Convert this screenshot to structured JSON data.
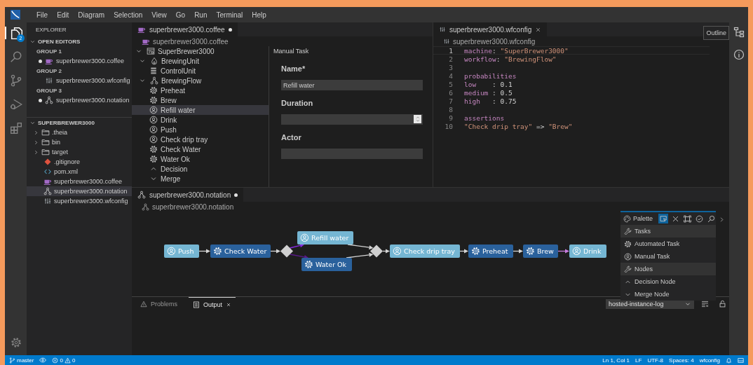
{
  "menu": [
    "File",
    "Edit",
    "Diagram",
    "Selection",
    "View",
    "Go",
    "Run",
    "Terminal",
    "Help"
  ],
  "activity_bar": {
    "items": [
      {
        "kind": "files",
        "selected": true,
        "badge": "2"
      },
      {
        "kind": "search",
        "selected": false
      },
      {
        "kind": "scm",
        "selected": false
      },
      {
        "kind": "debug",
        "selected": false
      },
      {
        "kind": "extensions",
        "selected": false
      }
    ]
  },
  "explorer": {
    "title": "EXPLORER",
    "open_editors": {
      "header": "OPEN EDITORS",
      "expanded": true,
      "groups": [
        {
          "label": "GROUP 1",
          "files": [
            {
              "name": "superbrewer3000.coffee",
              "kind": "coffee",
              "dirty": true
            }
          ]
        },
        {
          "label": "GROUP 2",
          "files": [
            {
              "name": "superbrewer3000.wfconfig",
              "kind": "wfconfig",
              "dirty": false
            }
          ]
        },
        {
          "label": "GROUP 3",
          "files": [
            {
              "name": "superbrewer3000.notation",
              "kind": "notation",
              "dirty": true
            }
          ]
        }
      ]
    },
    "project": {
      "header": "SUPERBREWER3000",
      "expanded": true,
      "items": [
        {
          "name": ".theia",
          "kind": "folder",
          "expanded": false,
          "selected": false
        },
        {
          "name": "bin",
          "kind": "folder",
          "expanded": false,
          "selected": false
        },
        {
          "name": "target",
          "kind": "folder",
          "expanded": false,
          "selected": false
        },
        {
          "name": ".gitignore",
          "kind": "git",
          "selected": false
        },
        {
          "name": "pom.xml",
          "kind": "xml",
          "selected": false
        },
        {
          "name": "superbrewer3000.coffee",
          "kind": "coffee",
          "selected": false
        },
        {
          "name": "superbrewer3000.notation",
          "kind": "notation",
          "selected": true
        },
        {
          "name": "superbrewer3000.wfconfig",
          "kind": "wfconfig",
          "selected": false
        }
      ]
    }
  },
  "coffee_editor": {
    "tab": {
      "label": "superbrewer3000.coffee",
      "kind": "coffee",
      "dirty": true
    },
    "breadcrumb": "superbrewer3000.coffee",
    "tree": [
      {
        "label": "SuperBrewer3000",
        "kind": "machine",
        "expanded": true,
        "selected": false,
        "children": [
          {
            "label": "BrewingUnit",
            "kind": "unit",
            "expanded": true,
            "selected": false,
            "children": [
              {
                "label": "ControlUnit",
                "kind": "controlunit",
                "selected": false
              }
            ]
          },
          {
            "label": "BrewingFlow",
            "kind": "notation",
            "expanded": true,
            "selected": false,
            "children": [
              {
                "label": "Preheat",
                "kind": "automated",
                "selected": false
              },
              {
                "label": "Brew",
                "kind": "automated",
                "selected": false
              },
              {
                "label": "Refill water",
                "kind": "manual",
                "selected": true
              },
              {
                "label": "Drink",
                "kind": "manual",
                "selected": false
              },
              {
                "label": "Push",
                "kind": "manual",
                "selected": false
              },
              {
                "label": "Check drip tray",
                "kind": "manual",
                "selected": false
              },
              {
                "label": "Check Water",
                "kind": "automated",
                "selected": false
              },
              {
                "label": "Water Ok",
                "kind": "automated",
                "selected": false
              },
              {
                "label": "Decision",
                "kind": "decision",
                "selected": false
              },
              {
                "label": "Merge",
                "kind": "merge",
                "selected": false
              }
            ]
          }
        ]
      }
    ],
    "properties": {
      "title": "Manual Task",
      "fields": [
        {
          "label": "Name*",
          "kind": "text",
          "value": "Refill water"
        },
        {
          "label": "Duration",
          "kind": "number"
        },
        {
          "label": "Actor",
          "kind": "text"
        }
      ]
    }
  },
  "wfconfig_editor": {
    "tab": {
      "label": "superbrewer3000.wfconfig",
      "kind": "wfconfig",
      "closable": true
    },
    "breadcrumb": "superbrewer3000.wfconfig",
    "lines": [
      {
        "number": "1",
        "current": true,
        "tokens": [
          {
            "text": "machine",
            "kind": "key"
          },
          {
            "text": ": ",
            "kind": "plain"
          },
          {
            "text": "\"SuperBrewer3000\"",
            "kind": "string"
          }
        ]
      },
      {
        "number": "2",
        "current": false,
        "tokens": [
          {
            "text": "workflow",
            "kind": "key"
          },
          {
            "text": ": ",
            "kind": "plain"
          },
          {
            "text": "\"BrewingFlow\"",
            "kind": "string"
          }
        ]
      },
      {
        "number": "3",
        "current": false
      },
      {
        "number": "4",
        "current": false,
        "tokens": [
          {
            "text": "probabilities",
            "kind": "key"
          }
        ]
      },
      {
        "number": "5",
        "current": false,
        "tokens": [
          {
            "text": "low",
            "kind": "key"
          },
          {
            "text": "    : 0.1",
            "kind": "plain"
          }
        ]
      },
      {
        "number": "6",
        "current": false,
        "tokens": [
          {
            "text": "medium",
            "kind": "key"
          },
          {
            "text": " : 0.5",
            "kind": "plain"
          }
        ]
      },
      {
        "number": "7",
        "current": false,
        "tokens": [
          {
            "text": "high",
            "kind": "key"
          },
          {
            "text": "   : 0.75",
            "kind": "plain"
          }
        ]
      },
      {
        "number": "8",
        "current": false
      },
      {
        "number": "9",
        "current": false,
        "tokens": [
          {
            "text": "assertions",
            "kind": "key"
          }
        ]
      },
      {
        "number": "10",
        "current": false,
        "tokens": [
          {
            "text": "\"Check drip tray\"",
            "kind": "string"
          },
          {
            "text": " => ",
            "kind": "plain"
          },
          {
            "text": "\"Brew\"",
            "kind": "string"
          }
        ]
      }
    ]
  },
  "notation_editor": {
    "tab": {
      "label": "superbrewer3000.notation",
      "kind": "notation",
      "dirty": true
    },
    "breadcrumb": "superbrewer3000.notation",
    "nodes": [
      {
        "label": "Push",
        "kind": "manual"
      },
      {
        "label": "Check Water",
        "kind": "automated"
      },
      {
        "kind": "decision"
      },
      {
        "label": "Refill water",
        "kind": "manual"
      },
      {
        "label": "Water Ok",
        "kind": "automated"
      },
      {
        "kind": "merge"
      },
      {
        "label": "Check drip tray",
        "kind": "manual"
      },
      {
        "label": "Preheat",
        "kind": "automated"
      },
      {
        "label": "Brew",
        "kind": "automated"
      },
      {
        "label": "Drink",
        "kind": "manual"
      }
    ],
    "edges": [
      {
        "color": "#d4d4d4"
      },
      {
        "color": "#d4d4d4"
      },
      {
        "color": "#8a2be2"
      },
      {
        "color": "#5b1a8c"
      },
      {
        "color": "#d4d4d4"
      },
      {
        "color": "#d4d4d4"
      },
      {
        "color": "#d4d4d4"
      },
      {
        "color": "#d4d4d4"
      },
      {
        "color": "#d4d4d4"
      },
      {
        "color": "#c77ddf"
      }
    ],
    "palette": {
      "title": "Palette",
      "tools": [
        {
          "kind": "select",
          "selected": true
        },
        {
          "kind": "delete",
          "selected": false
        },
        {
          "kind": "marquee",
          "selected": false
        },
        {
          "kind": "validate",
          "selected": false
        },
        {
          "kind": "search",
          "selected": false
        }
      ],
      "groups": [
        {
          "label": "Tasks",
          "items": [
            {
              "label": "Automated Task",
              "kind": "automated"
            },
            {
              "label": "Manual Task",
              "kind": "manual"
            }
          ]
        },
        {
          "label": "Nodes",
          "items": [
            {
              "label": "Decision Node",
              "kind": "decision"
            },
            {
              "label": "Merge Node",
              "kind": "merge"
            }
          ]
        }
      ]
    }
  },
  "right_bar": {
    "tooltip": "Outline"
  },
  "panel": {
    "tabs": [
      {
        "label": "Problems",
        "kind": "problems",
        "selected": false,
        "closable": false
      },
      {
        "label": "Output",
        "kind": "output",
        "selected": true,
        "closable": true
      }
    ],
    "channel": "hosted-instance-log"
  },
  "status_bar": {
    "branch": "master",
    "errors": "0",
    "warnings": "0",
    "right": [
      "Ln 1, Col 1",
      "LF",
      "UTF-8",
      "Spaces: 4",
      "wfconfig"
    ]
  }
}
